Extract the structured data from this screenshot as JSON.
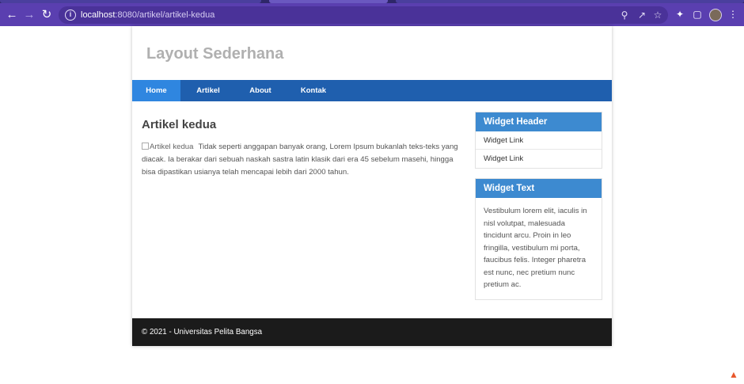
{
  "browser": {
    "url_host": "localhost",
    "url_rest": ":8080/artikel/artikel-kedua",
    "back_icon": "arrow-left-icon",
    "forward_icon": "arrow-right-icon",
    "reload_icon": "reload-icon"
  },
  "site": {
    "title": "Layout Sederhana"
  },
  "nav": {
    "items": [
      {
        "label": "Home",
        "active": true
      },
      {
        "label": "Artikel",
        "active": false
      },
      {
        "label": "About",
        "active": false
      },
      {
        "label": "Kontak",
        "active": false
      }
    ]
  },
  "article": {
    "title": "Artikel kedua",
    "image_alt": "Artikel kedua",
    "body": "Tidak seperti anggapan banyak orang, Lorem Ipsum bukanlah teks-teks yang diacak. Ia berakar dari sebuah naskah sastra latin klasik dari era 45 sebelum masehi, hingga bisa dipastikan usianya telah mencapai lebih dari 2000 tahun."
  },
  "sidebar": {
    "widget1": {
      "header": "Widget Header",
      "links": [
        "Widget Link",
        "Widget Link"
      ]
    },
    "widget2": {
      "header": "Widget Text",
      "text": "Vestibulum lorem elit, iaculis in nisl volutpat, malesuada tincidunt arcu. Proin in leo fringilla, vestibulum mi porta, faucibus felis. Integer pharetra est nunc, nec pretium nunc pretium ac."
    }
  },
  "footer": {
    "text": "© 2021 - Universitas Pelita Bangsa"
  },
  "colors": {
    "chrome": "#5a3fb0",
    "navbar": "#1f5fae",
    "nav_active": "#2f86e0",
    "widget_header": "#3d8ad0",
    "footer": "#1b1b1b"
  }
}
